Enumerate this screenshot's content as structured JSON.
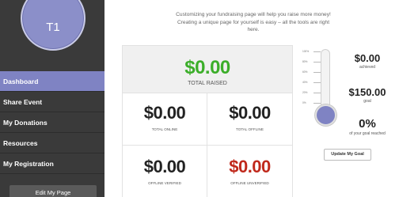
{
  "profile": {
    "initials": "T1"
  },
  "sidebar": {
    "items": [
      {
        "label": "Dashboard",
        "active": true
      },
      {
        "label": "Share Event",
        "active": false
      },
      {
        "label": "My Donations",
        "active": false
      },
      {
        "label": "Resources",
        "active": false
      },
      {
        "label": "My Registration",
        "active": false
      }
    ],
    "edit_button": "Edit My Page"
  },
  "intro": {
    "line1": "Customizing your fundraising page will help you raise more money!",
    "line2": "Creating a unique page for yourself is easy – all the tools are right",
    "line3": "here."
  },
  "stats": {
    "total_raised": {
      "amount": "$0.00",
      "label": "TOTAL RAISED"
    },
    "total_online": {
      "amount": "$0.00",
      "label": "TOTAL ONLINE"
    },
    "total_offline": {
      "amount": "$0.00",
      "label": "TOTAL OFFLINE"
    },
    "offline_verified": {
      "amount": "$0.00",
      "label": "OFFLINE VERIFIED"
    },
    "offline_unverified": {
      "amount": "$0.00",
      "label": "OFFLINE UNVERIFIED"
    }
  },
  "thermometer": {
    "ticks": [
      "100%",
      "80%",
      "60%",
      "40%",
      "20%",
      "0%"
    ],
    "progress": 0
  },
  "summary": {
    "achieved_amount": "$0.00",
    "achieved_label": "achieved",
    "goal_amount": "$150.00",
    "goal_label": "goal",
    "percent": "0%",
    "percent_label": "of your goal reached"
  },
  "update_goal_button": "Update My Goal",
  "colors": {
    "accent": "#7f83c3",
    "sidebar_bg": "#3a3a3a",
    "raised_green": "#3cae2a",
    "unverified_red": "#c0291c"
  }
}
